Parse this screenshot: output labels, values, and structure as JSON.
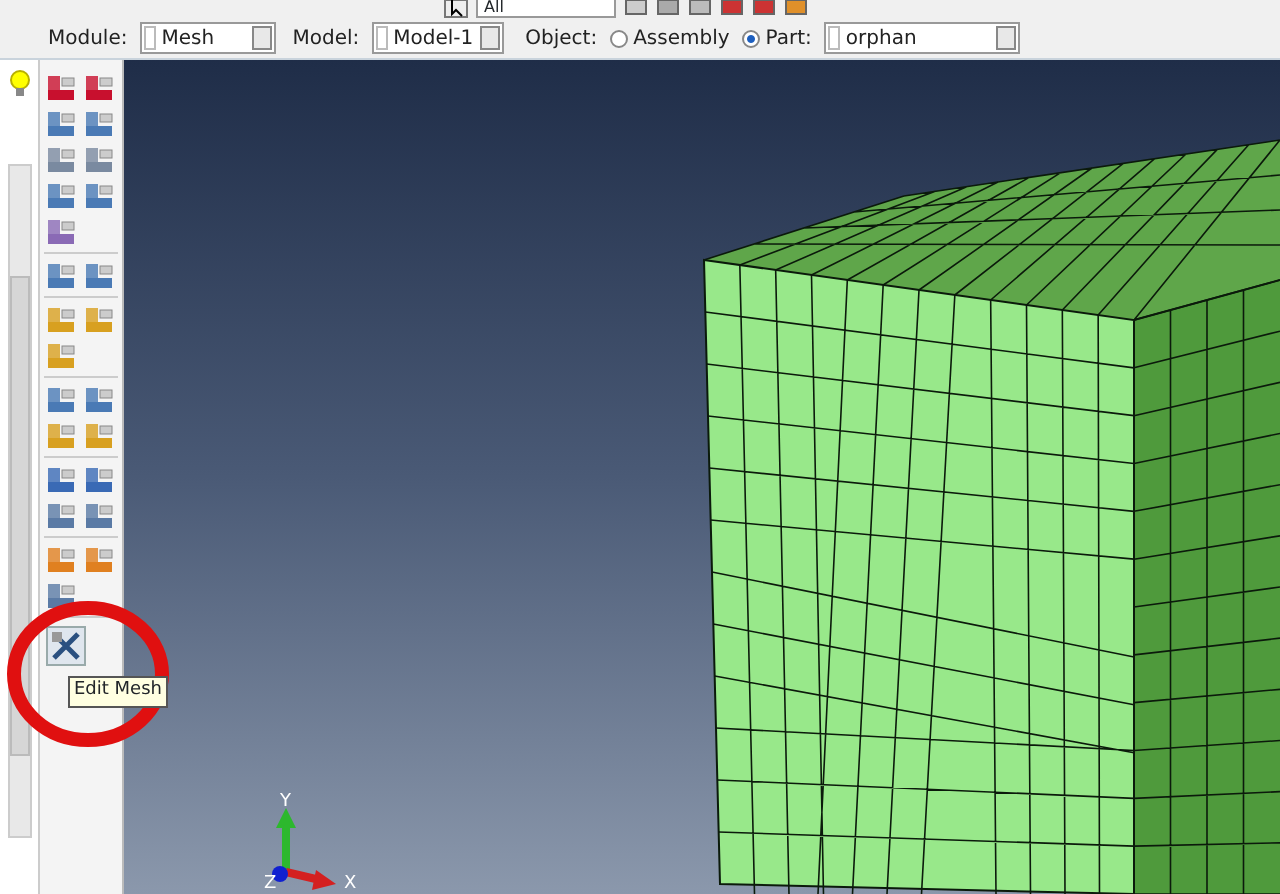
{
  "toolbar": {
    "selection_field": "All"
  },
  "context_bar": {
    "module_label": "Module:",
    "module": "Mesh",
    "model_label": "Model:",
    "model": "Model-1",
    "object_label": "Object:",
    "objects": [
      {
        "label": "Assembly",
        "selected": false
      },
      {
        "label": "Part:",
        "selected": true
      }
    ],
    "part": "orphan"
  },
  "tooltip": "Edit Mesh",
  "axes": [
    {
      "label": "Y"
    },
    {
      "label": "Z"
    },
    {
      "label": "X"
    }
  ]
}
